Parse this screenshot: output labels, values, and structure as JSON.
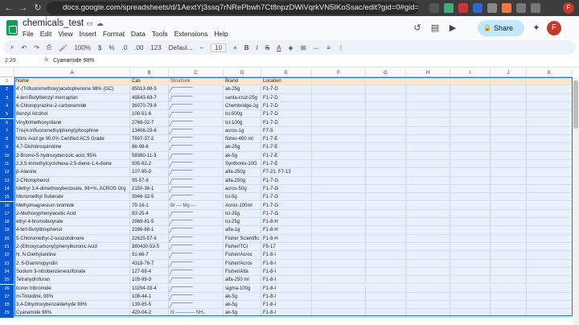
{
  "browser": {
    "url": "docs.google.com/spreadsheets/d/1AextYj3ssq7rNRePbwh7Ct8npzDWiVqrkVN5IKoSsac/edit?gid=0#gid=0"
  },
  "doc": {
    "title": "chemicals_test",
    "menu": [
      "File",
      "Edit",
      "View",
      "Insert",
      "Format",
      "Data",
      "Tools",
      "Extensions",
      "Help"
    ],
    "share_label": "Share",
    "avatar_letter": "F"
  },
  "toolbar": {
    "zoom": "100%",
    "currency": "$",
    "percent": "%",
    "decimals_less": ".0",
    "decimals_more": ".00",
    "number_format": "123",
    "font": "Defaul...",
    "font_size": "10",
    "minus": "−",
    "plus": "+"
  },
  "formula_bar": {
    "cell_ref": "2:29",
    "fx": "fx",
    "value": "Cyanamide 98%"
  },
  "columns": [
    "A",
    "B",
    "C",
    "D",
    "E",
    "F",
    "G",
    "H",
    "I",
    "J",
    "K"
  ],
  "header_row": {
    "num": "1",
    "A": "Name",
    "B": "Cas",
    "C": "Structure",
    "D": "Brand",
    "E": "Location"
  },
  "rows": [
    {
      "num": "2",
      "A": "4'-(Trifluoromethoxy)acetophenone 98% (GC)",
      "B": "85013-98-5",
      "C": "",
      "D": "ak-25g",
      "E": "F1-7-D"
    },
    {
      "num": "3",
      "A": "4-tert-Butylbenzyl mercaptan",
      "B": "49543-63-7",
      "C": "",
      "D": "santa-cruz-25g",
      "E": "F1-7-D"
    },
    {
      "num": "4",
      "A": "6-Chloropyrazine-2-carboxamide",
      "B": "36070-79-8",
      "C": "",
      "D": "Chembridge-2g",
      "E": "F1-7-D"
    },
    {
      "num": "5",
      "A": "Benzyl Alcohol",
      "B": "100-51-6",
      "C": "",
      "D": "tci-500g",
      "E": "F1-7-D"
    },
    {
      "num": "6",
      "A": "Vinyltrimethoxysilane",
      "B": "2768-02-7",
      "C": "",
      "D": "tci-100g",
      "E": "F1-7-D"
    },
    {
      "num": "7",
      "A": "Tris(4-trifluoromethylphenyl)phosphine",
      "B": "13406-29-6",
      "C": "",
      "D": "acros-1g",
      "E": "F7-5"
    },
    {
      "num": "8",
      "A": "Nitric Acid ge 90.0% Certified ACS Grade",
      "B": "7697-37-2",
      "C": "",
      "D": "fisher-450 ml",
      "E": "F1-7-E"
    },
    {
      "num": "9",
      "A": "4,7-Dichloroquinoline",
      "B": "86-98-6",
      "C": "",
      "D": "ak-25g",
      "E": "F1-7-E"
    },
    {
      "num": "10",
      "A": "2-Bromo-5-hydroxybenzoic acid, 95%",
      "B": "58380-11-3",
      "C": "",
      "D": "ak-5g",
      "E": "F1-7-E"
    },
    {
      "num": "11",
      "A": "2,3,5-trimethylcyclohexa-2,5-diene-1,4-dione",
      "B": "935-92-2",
      "C": "",
      "D": "Synthonix-10G",
      "E": "F1-7-E"
    },
    {
      "num": "12",
      "A": "β-Alanine",
      "B": "107-95-9",
      "C": "",
      "D": "alfa-250g",
      "E": "F7-21, F7-13"
    },
    {
      "num": "13",
      "A": "2-Chlorophenol",
      "B": "95-57-8",
      "C": "",
      "D": "alfa-250g",
      "E": "F1-7-G"
    },
    {
      "num": "14",
      "A": "Methyl 3,4-dimethoxybenzoate, 98+%, ACROS Org",
      "B": "2150-38-1",
      "C": "",
      "D": "acros-50g",
      "E": "F1-7-G"
    },
    {
      "num": "15",
      "A": "Monomethyl Suberate",
      "B": "3946-32-5",
      "C": "",
      "D": "tci-5g",
      "E": "F1-7-G"
    },
    {
      "num": "16",
      "A": "Methylmagnesium bromide",
      "B": "75-16-1",
      "C": "Br — Mg —",
      "D": "Acros-100ml",
      "E": "F1-7-G"
    },
    {
      "num": "17",
      "A": "2-Methoxyphenylacetic Acid",
      "B": "93-25-4",
      "C": "",
      "D": "tci-25g",
      "E": "F1-7-G"
    },
    {
      "num": "18",
      "A": "ethyl 4-bromobutyrate",
      "B": "2969-81-5",
      "C": "",
      "D": "tci-25g",
      "E": "F1-8-H"
    },
    {
      "num": "19",
      "A": "4-tert-Butylthiophenol",
      "B": "2396-68-1",
      "C": "",
      "D": "alfa-1g",
      "E": "F1-8-H"
    },
    {
      "num": "20",
      "A": "5-Chloromethyl-2-oxazolidinone",
      "B": "22625-57-6",
      "C": "",
      "D": "Fisher Scientific",
      "E": "F1-8-H"
    },
    {
      "num": "21",
      "A": "2-(Ethoxycarbonyl)phenylboronic Acid",
      "B": "380430-53-5",
      "C": "",
      "D": "Fisher/TCI",
      "E": "F5-17"
    },
    {
      "num": "22",
      "A": "N, N-Diethylaniline",
      "B": "91-66-7",
      "C": "",
      "D": "Fisher/Acros",
      "E": "F1-8-I"
    },
    {
      "num": "23",
      "A": "2, 5-Diaminopyridin",
      "B": "4318-76-7",
      "C": "",
      "D": "Fisher/Acros",
      "E": "F1-8-I"
    },
    {
      "num": "24",
      "A": "Sodium 3-nitrobenzenesulfonate",
      "B": "127-68-4",
      "C": "",
      "D": "Fisher/Alfa",
      "E": "F1-8-I"
    },
    {
      "num": "25",
      "A": "Tetrahydrofuran",
      "B": "109-99-9",
      "C": "",
      "D": "alfa-250 ml",
      "E": "F1-8-I"
    },
    {
      "num": "26",
      "A": "boron tribromide",
      "B": "10294-33-4",
      "C": "",
      "D": "sigma-100g",
      "E": "F1-8-I"
    },
    {
      "num": "27",
      "A": "m-Toluidine, 98%",
      "B": "108-44-1",
      "C": "",
      "D": "ak-5g",
      "E": "F1-8-I"
    },
    {
      "num": "28",
      "A": "3,4-Dihydroxybenzaldehyde 98%",
      "B": "139-85-5",
      "C": "",
      "D": "ak-5g",
      "E": "F1-8-I"
    },
    {
      "num": "29",
      "A": "Cyanamide 98%",
      "B": "420-04-2",
      "C": "N ———— NH₂",
      "D": "ak-5g",
      "E": "F1-8-I"
    }
  ]
}
